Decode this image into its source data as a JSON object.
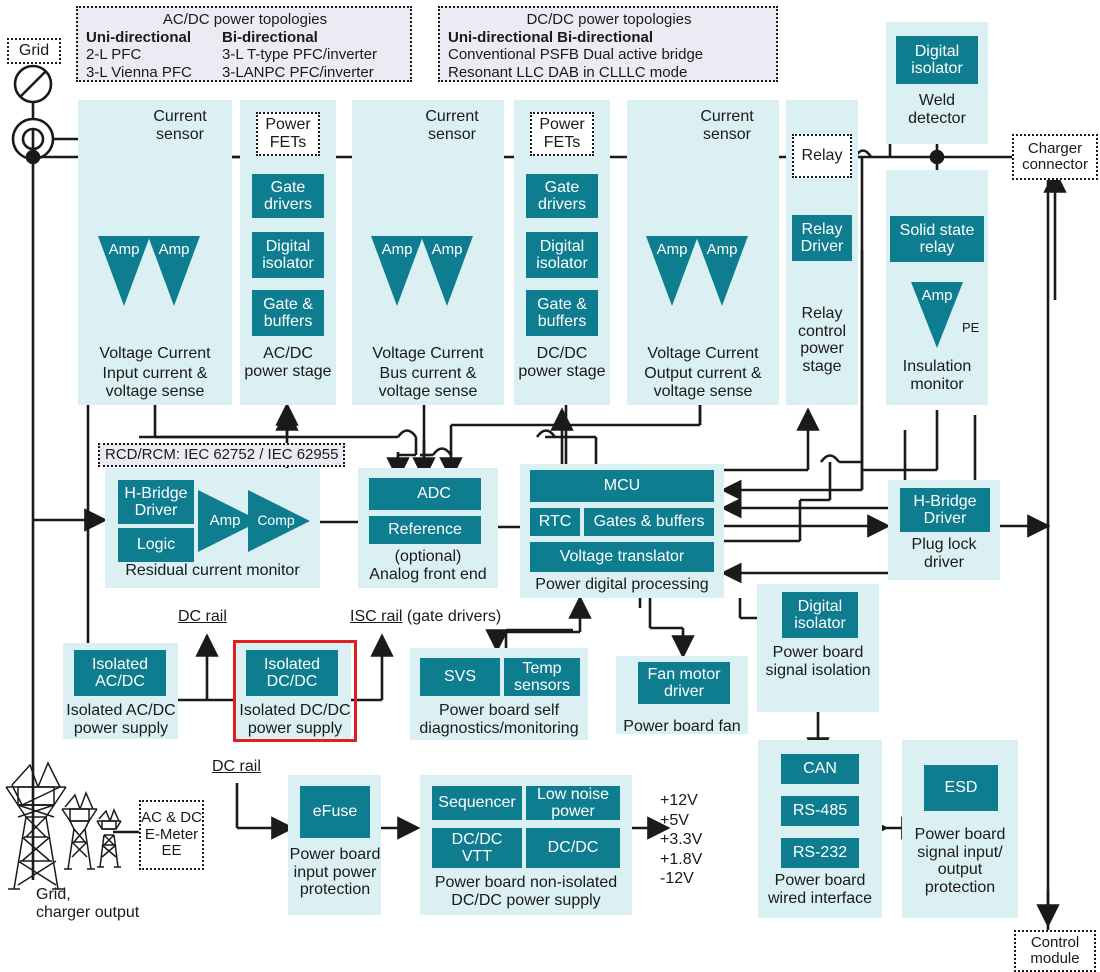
{
  "diagram": {
    "title": "EV charging station power and control block diagram",
    "colors": {
      "teal": "#0f7d90",
      "panel": "#daf0f2",
      "note": "#ecebf3",
      "highlight": "#e02020",
      "line": "#1a1a1a"
    }
  },
  "notes": [
    {
      "heading": "AC/DC power topologies",
      "col1_head": "Uni-directional",
      "col2_head": "Bi-directional",
      "rows": [
        [
          "2-L PFC",
          "3-L T-type PFC/inverter"
        ],
        [
          "3-L Vienna PFC",
          "3-LANPC PFC/inverter"
        ]
      ]
    },
    {
      "heading": "DC/DC power topologies",
      "line2": "Uni-directional Bi-directional",
      "line3": "Conventional PSFB Dual active bridge",
      "line4": "Resonant LLC DAB in CLLLC mode"
    }
  ],
  "grid": {
    "label": "Grid"
  },
  "sense": [
    {
      "title": "Current\nsensor",
      "amp1": "Amp",
      "amp2": "Amp",
      "cap1": "Voltage Current",
      "cap2": "Input current &\nvoltage sense"
    },
    {
      "title": "Current\nsensor",
      "amp1": "Amp",
      "amp2": "Amp",
      "cap1": "Voltage Current",
      "cap2": "Bus current &\nvoltage sense"
    },
    {
      "title": "Current\nsensor",
      "amp1": "Amp",
      "amp2": "Amp",
      "cap1": "Voltage Current",
      "cap2": "Output current &\nvoltage sense"
    }
  ],
  "stages": [
    {
      "fets": "Power\nFETs",
      "chips": [
        "Gate\ndrivers",
        "Digital\nisolator",
        "Gate &\nbuffers"
      ],
      "caption": "AC/DC\npower stage"
    },
    {
      "fets": "Power\nFETs",
      "chips": [
        "Gate\ndrivers",
        "Digital\nisolator",
        "Gate &\nbuffers"
      ],
      "caption": "DC/DC\npower stage"
    }
  ],
  "relay": {
    "box": "Relay",
    "driver": "Relay\nDriver",
    "caption": "Relay\ncontrol\npower\nstage"
  },
  "weld": {
    "chip": "Digital\nisolator",
    "caption": "Weld\ndetector"
  },
  "insulation": {
    "chip": "Solid state\nrelay",
    "amp": "Amp",
    "pe": "PE",
    "caption": "Insulation\nmonitor"
  },
  "charger_connector": {
    "label": "Charger\nconnector"
  },
  "rcd": {
    "note": "RCD/RCM: IEC 62752 / IEC 62955",
    "chips": [
      "H-Bridge\nDriver",
      "Logic"
    ],
    "amp": "Amp",
    "comp": "Comp",
    "caption": "Residual current monitor"
  },
  "afe": {
    "adc": "ADC",
    "reference": "Reference",
    "caption": "(optional)\nAnalog front end"
  },
  "pdp": {
    "mcu": "MCU",
    "rtc": "RTC",
    "gates": "Gates & buffers",
    "vtrans": "Voltage translator",
    "caption": "Power digital processing"
  },
  "plug_lock": {
    "chip": "H-Bridge\nDriver",
    "caption": "Plug lock\ndriver"
  },
  "board_isolation": {
    "chip": "Digital\nisolator",
    "caption": "Power board\nsignal isolation"
  },
  "rails": {
    "dc_rail_1": "DC rail",
    "isc_rail": "ISC rail (gate drivers)",
    "dc_rail_2": "DC rail",
    "dc_rail_1_u": "DC rail",
    "isc_rail_u": "ISC rail",
    "isc_rail_rest": " (gate drivers)"
  },
  "isolated_acdc": {
    "chip": "Isolated\nAC/DC",
    "caption": "Isolated AC/DC\npower supply"
  },
  "isolated_dcdc": {
    "chip": "Isolated\nDC/DC",
    "caption": "Isolated DC/DC\npower supply"
  },
  "self_diag": {
    "chips": [
      "SVS",
      "Temp\nsensors"
    ],
    "caption": "Power board self\ndiagnostics/monitoring"
  },
  "fan": {
    "chip": "Fan motor\ndriver",
    "caption": "Power board fan"
  },
  "efuse": {
    "chip": "eFuse",
    "caption": "Power board\ninput power\nprotection"
  },
  "noniso": {
    "chips": [
      "Sequencer",
      "Low noise\npower",
      "DC/DC\nVTT",
      "DC/DC"
    ],
    "caption": "Power board non-isolated\nDC/DC power supply"
  },
  "outputs": {
    "values": "+12V\n+5V\n+3.3V\n+1.8V\n-12V"
  },
  "wired": {
    "chips": [
      "CAN",
      "RS-485",
      "RS-232"
    ],
    "caption": "Power board\nwired interface"
  },
  "esd": {
    "chip": "ESD",
    "caption": "Power board\nsignal input/\noutput\nprotection"
  },
  "control_module": {
    "label": "Control\nmodule"
  },
  "tower": {
    "caption": "Grid,\ncharger output",
    "meter": "AC & DC\nE-Meter\nEE"
  }
}
